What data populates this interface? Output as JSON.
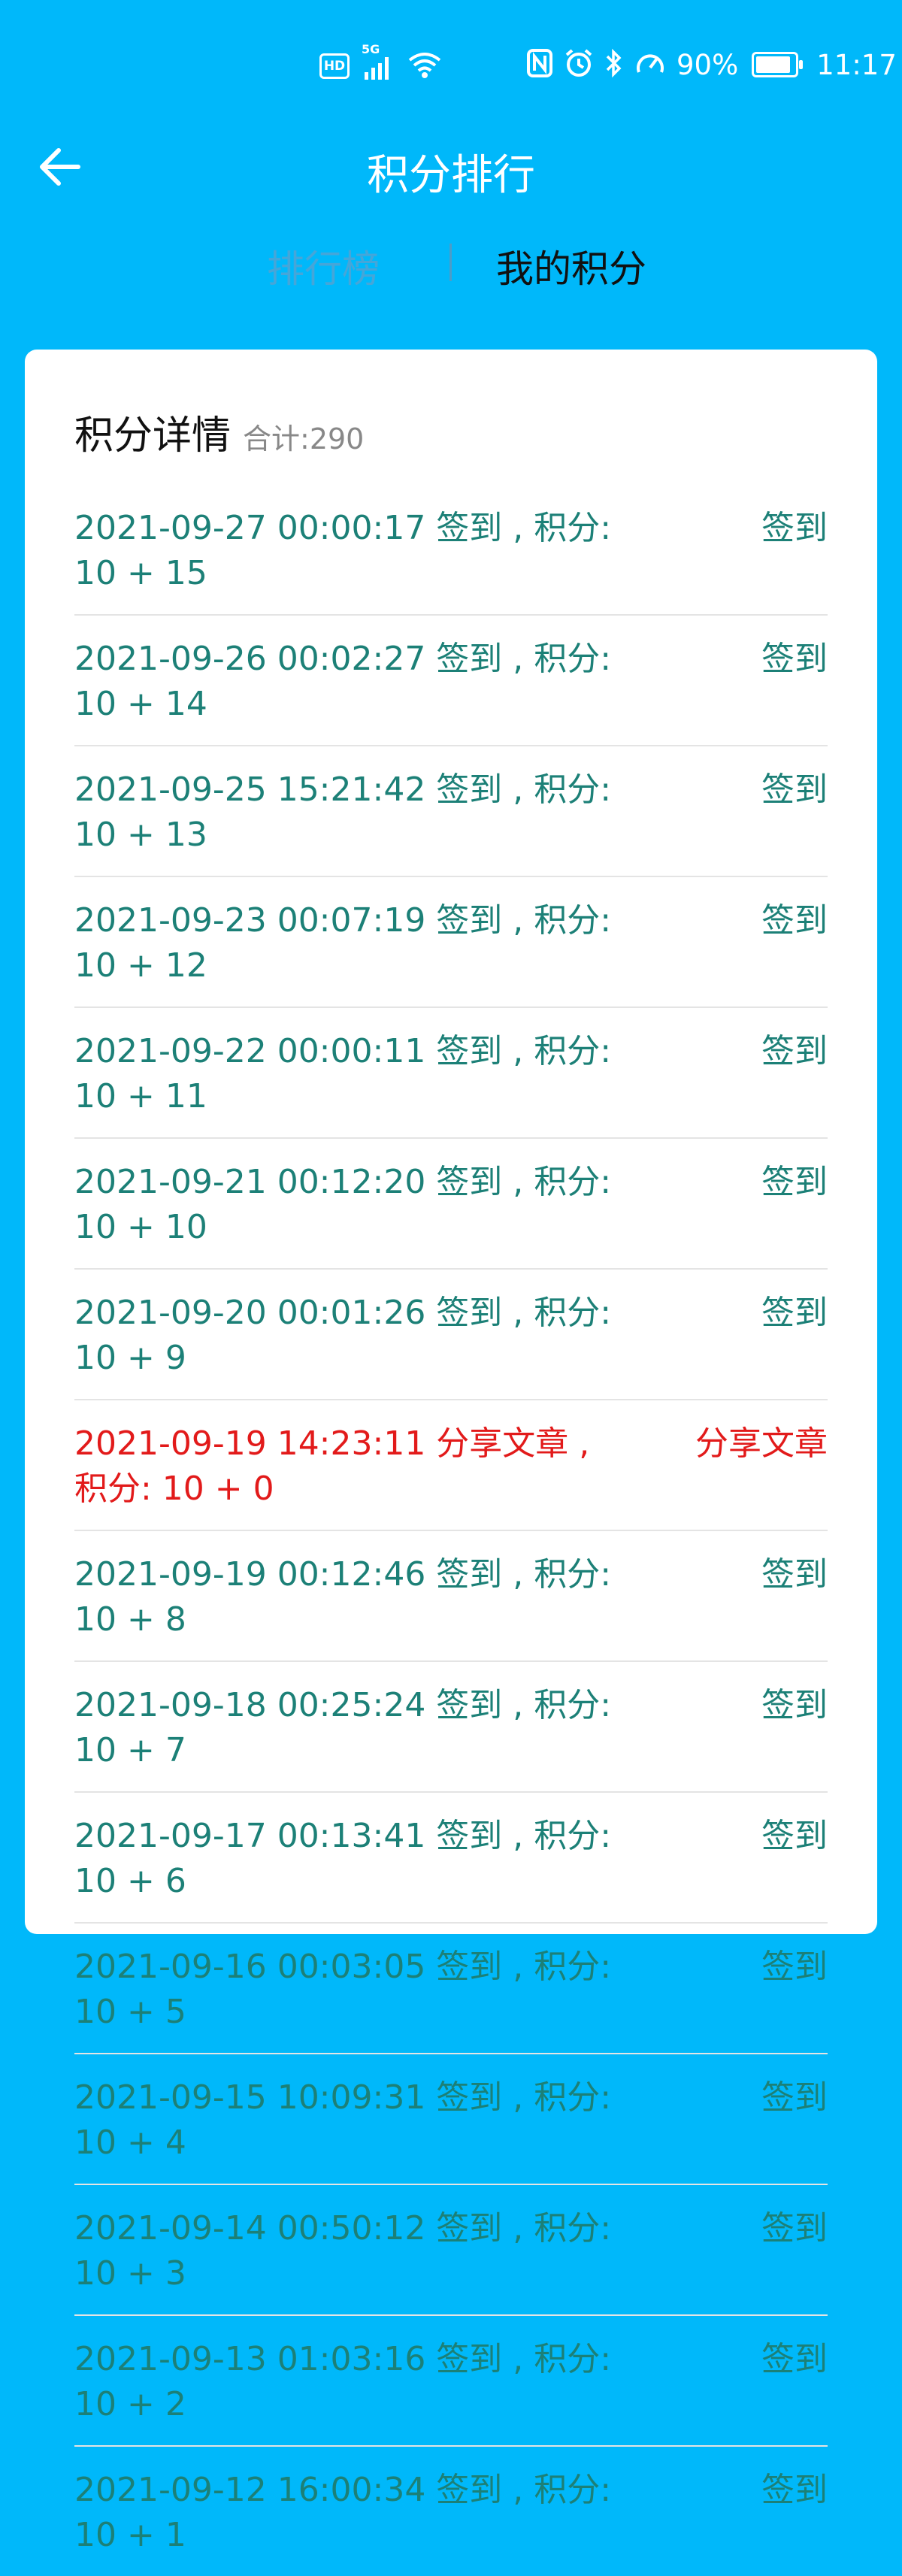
{
  "status_bar": {
    "hd": "HD",
    "network": "5G",
    "battery_level": 0.9,
    "battery_text": "90%",
    "time": "11:17"
  },
  "header": {
    "title": "积分排行"
  },
  "tabs": {
    "ranking": "排行榜",
    "mine": "我的积分"
  },
  "card": {
    "title": "积分详情",
    "total_label": "合计:",
    "total_value": "290"
  },
  "records": [
    {
      "text": "2021-09-27 00:00:17 签到 , 积分:  10 + 15",
      "type": "签到"
    },
    {
      "text": "2021-09-26 00:02:27 签到 , 积分:  10 + 14",
      "type": "签到"
    },
    {
      "text": "2021-09-25 15:21:42 签到 , 积分:  10 + 13",
      "type": "签到"
    },
    {
      "text": "2021-09-23 00:07:19 签到 , 积分:  10 + 12",
      "type": "签到"
    },
    {
      "text": "2021-09-22 00:00:11 签到 , 积分:  10 + 11",
      "type": "签到"
    },
    {
      "text": "2021-09-21 00:12:20 签到 , 积分:  10 + 10",
      "type": "签到"
    },
    {
      "text": "2021-09-20 00:01:26 签到 , 积分:  10 + 9",
      "type": "签到"
    },
    {
      "text": "2021-09-19 14:23:11 分享文章 , 积分:  10 + 0",
      "type": "分享文章"
    },
    {
      "text": "2021-09-19 00:12:46 签到 , 积分:  10 + 8",
      "type": "签到"
    },
    {
      "text": "2021-09-18 00:25:24 签到 , 积分:  10 + 7",
      "type": "签到"
    },
    {
      "text": "2021-09-17 00:13:41 签到 , 积分:  10 + 6",
      "type": "签到"
    },
    {
      "text": "2021-09-16 00:03:05 签到 , 积分:  10 + 5",
      "type": "签到"
    },
    {
      "text": "2021-09-15 10:09:31 签到 , 积分:  10 + 4",
      "type": "签到"
    },
    {
      "text": "2021-09-14 00:50:12 签到 , 积分:  10 + 3",
      "type": "签到"
    },
    {
      "text": "2021-09-13 01:03:16 签到 , 积分:  10 + 2",
      "type": "签到"
    },
    {
      "text": "2021-09-12 16:00:34 签到 , 积分:  10 + 1",
      "type": "签到"
    }
  ],
  "colors": {
    "background": "#00B8FA",
    "checkin": "#1C8077",
    "share": "#E21A1A"
  }
}
